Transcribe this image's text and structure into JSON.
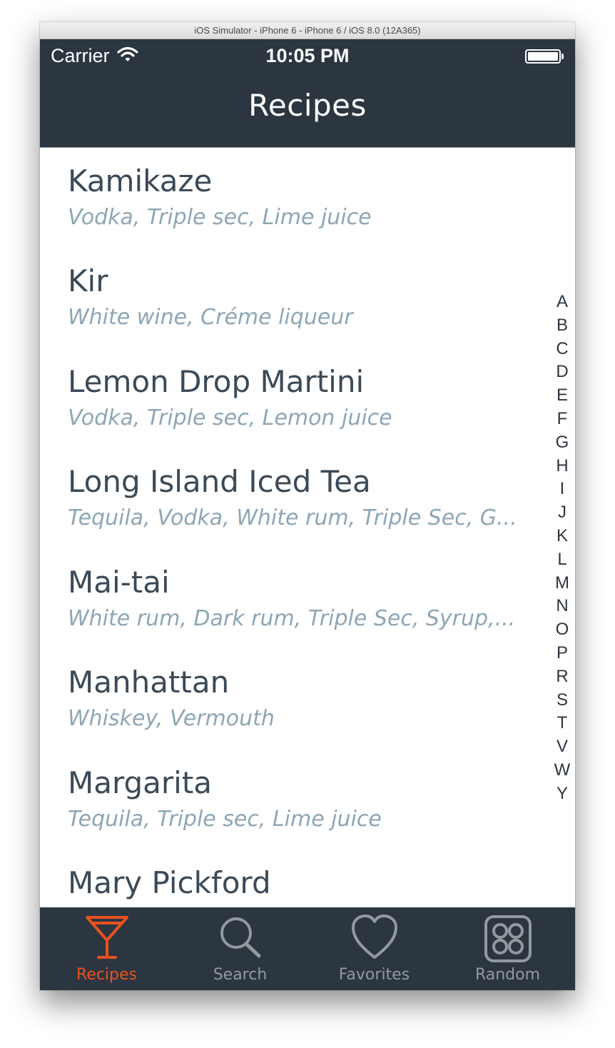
{
  "simulator": {
    "window_title": "iOS Simulator - iPhone 6 - iPhone 6 / iOS 8.0 (12A365)"
  },
  "status_bar": {
    "carrier": "Carrier",
    "time": "10:05 PM",
    "icons": [
      "wifi-icon",
      "battery-icon"
    ]
  },
  "navbar": {
    "title": "Recipes"
  },
  "recipes": [
    {
      "name": "Kamikaze",
      "ingredients": "Vodka, Triple sec, Lime juice"
    },
    {
      "name": "Kir",
      "ingredients": "White wine, Créme liqueur"
    },
    {
      "name": "Lemon Drop Martini",
      "ingredients": "Vodka, Triple sec, Lemon juice"
    },
    {
      "name": "Long Island Iced Tea",
      "ingredients": "Tequila, Vodka, White rum, Triple Sec, G..."
    },
    {
      "name": "Mai-tai",
      "ingredients": "White rum, Dark rum, Triple Sec, Syrup,..."
    },
    {
      "name": "Manhattan",
      "ingredients": "Whiskey, Vermouth"
    },
    {
      "name": "Margarita",
      "ingredients": "Tequila, Triple sec, Lime juice"
    },
    {
      "name": "Mary Pickford",
      "ingredients": ""
    }
  ],
  "section_index": [
    "A",
    "B",
    "C",
    "D",
    "E",
    "F",
    "G",
    "H",
    "I",
    "J",
    "K",
    "L",
    "M",
    "N",
    "O",
    "P",
    "R",
    "S",
    "T",
    "V",
    "W",
    "Y"
  ],
  "tabbar": {
    "tabs": [
      {
        "label": "Recipes",
        "icon": "cocktail-glass-icon",
        "active": true
      },
      {
        "label": "Search",
        "icon": "magnifier-icon",
        "active": false
      },
      {
        "label": "Favorites",
        "icon": "heart-icon",
        "active": false
      },
      {
        "label": "Random",
        "icon": "dice-icon",
        "active": false
      }
    ]
  },
  "colors": {
    "bar_background": "#2c3640",
    "accent_active": "#e8521e",
    "inactive_tab": "#939a9f",
    "recipe_name": "#3b4a57",
    "ingredients": "#8ea6b5"
  }
}
